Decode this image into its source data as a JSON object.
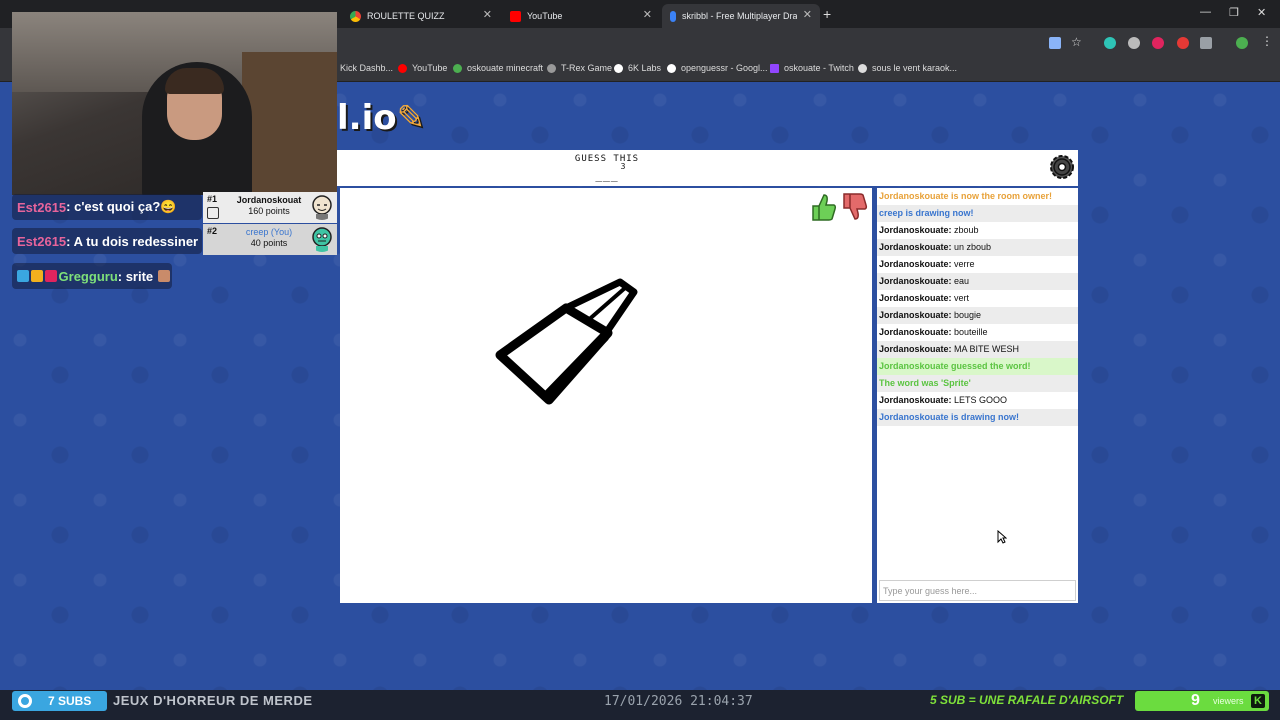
{
  "browser": {
    "tabs": [
      {
        "label": "ROULETTE QUIZZ",
        "color": "#e53935"
      },
      {
        "label": "YouTube",
        "color": "#ff0000"
      },
      {
        "label": "skribbl - Free Multiplayer Draw",
        "color": "#3b82f6"
      }
    ],
    "bookmarks": [
      {
        "label": "Kick Dashb...",
        "color": "#53fc18"
      },
      {
        "label": "YouTube",
        "color": "#ff0000"
      },
      {
        "label": "oskouate minecraft",
        "color": "#4caf50"
      },
      {
        "label": "T-Rex Game",
        "color": "#999999"
      },
      {
        "label": "6K Labs",
        "color": "#ffffff"
      },
      {
        "label": "openguessr - Googl...",
        "color": "#ffffff"
      },
      {
        "label": "oskouate - Twitch",
        "color": "#9146ff"
      },
      {
        "label": "sous le vent karaok...",
        "color": "#dddddd"
      }
    ]
  },
  "overlay_chat": [
    {
      "user": "Est2615",
      "text": ": c'est quoi ça?😄"
    },
    {
      "user": "Est2615",
      "text": ": A tu dois redessiner"
    },
    {
      "user": "Gregguru",
      "text": ": srite"
    }
  ],
  "game": {
    "logo_text": "l.io",
    "guess_label": "GUESS THIS",
    "guess_count": "3",
    "guess_word": "___",
    "players": [
      {
        "rank": "#1",
        "name": "Jordanoskouat",
        "points": "160 points"
      },
      {
        "rank": "#2",
        "name": "creep (You)",
        "points": "40 points"
      }
    ],
    "chat": [
      {
        "style": "orange",
        "text": "Jordanoskouate is now the room owner!"
      },
      {
        "style": "blue alt",
        "text": "creep is drawing now!"
      },
      {
        "style": "plain",
        "user": "Jordanoskouate:",
        "text": " zboub"
      },
      {
        "style": "plain alt",
        "user": "Jordanoskouate:",
        "text": " un zboub"
      },
      {
        "style": "plain",
        "user": "Jordanoskouate:",
        "text": " verre"
      },
      {
        "style": "plain alt",
        "user": "Jordanoskouate:",
        "text": " eau"
      },
      {
        "style": "plain",
        "user": "Jordanoskouate:",
        "text": " vert"
      },
      {
        "style": "plain alt",
        "user": "Jordanoskouate:",
        "text": " bougie"
      },
      {
        "style": "plain",
        "user": "Jordanoskouate:",
        "text": " bouteille"
      },
      {
        "style": "plain alt",
        "user": "Jordanoskouate:",
        "text": " MA BITE WESH"
      },
      {
        "style": "green-bg",
        "text": "Jordanoskouate guessed the word!"
      },
      {
        "style": "green alt",
        "text": "The word was 'Sprite'"
      },
      {
        "style": "plain",
        "user": "Jordanoskouate:",
        "text": " LETS GOOO"
      },
      {
        "style": "blue alt",
        "text": "Jordanoskouate is drawing now!"
      }
    ],
    "input_placeholder": "Type your guess here..."
  },
  "stream_bar": {
    "subs": "7 SUBS",
    "ticker": "JEUX D'HORREUR DE MERDE",
    "clock": "17/01/2026 21:04:37",
    "promo": "5 SUB = UNE RAFALE D'AIRSOFT",
    "viewers_count": "9",
    "viewers_label": "viewers"
  }
}
